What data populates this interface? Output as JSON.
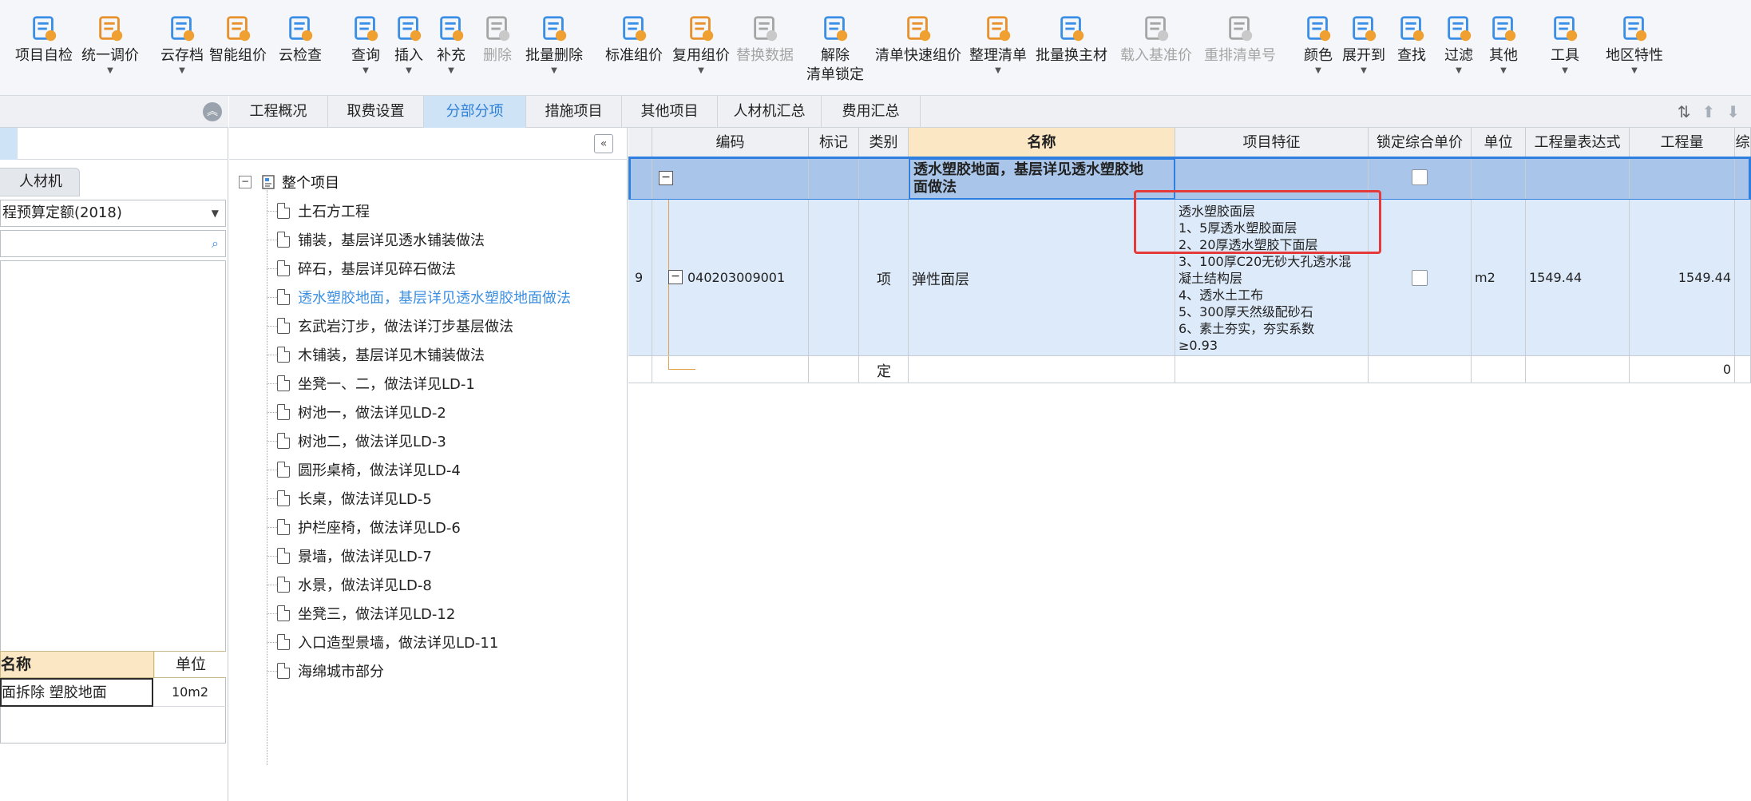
{
  "toolbar": {
    "buttons": [
      {
        "label": "项目自检",
        "icon": "check-doc-icon",
        "caret": false,
        "disabled": false
      },
      {
        "label": "统一调价",
        "icon": "adjust-price-icon",
        "caret": true,
        "disabled": false
      },
      {
        "label": "云存档",
        "icon": "cloud-save-icon",
        "caret": true,
        "disabled": false
      },
      {
        "label": "智能组价",
        "icon": "smart-price-icon",
        "caret": false,
        "disabled": false
      },
      {
        "label": "云检查",
        "icon": "cloud-check-icon",
        "caret": false,
        "disabled": false
      },
      {
        "label": "查询",
        "icon": "query-icon",
        "caret": true,
        "disabled": false
      },
      {
        "label": "插入",
        "icon": "insert-icon",
        "caret": true,
        "disabled": false
      },
      {
        "label": "补充",
        "icon": "supplement-icon",
        "caret": true,
        "disabled": false
      },
      {
        "label": "删除",
        "icon": "delete-icon",
        "caret": false,
        "disabled": true
      },
      {
        "label": "批量删除",
        "icon": "batch-delete-icon",
        "caret": true,
        "disabled": false
      },
      {
        "label": "标准组价",
        "icon": "standard-price-icon",
        "caret": false,
        "disabled": false
      },
      {
        "label": "复用组价",
        "icon": "reuse-price-icon",
        "caret": true,
        "disabled": false
      },
      {
        "label": "替换数据",
        "icon": "replace-data-icon",
        "caret": false,
        "disabled": true
      },
      {
        "label": "解除",
        "label2": "清单锁定",
        "icon": "unlock-icon",
        "caret": false,
        "disabled": false
      },
      {
        "label": "清单快速组价",
        "icon": "quick-price-icon",
        "caret": false,
        "disabled": false
      },
      {
        "label": "整理清单",
        "icon": "organize-list-icon",
        "caret": true,
        "disabled": false
      },
      {
        "label": "批量换主材",
        "icon": "batch-material-icon",
        "caret": false,
        "disabled": false
      },
      {
        "label": "载入基准价",
        "icon": "load-baseline-icon",
        "caret": false,
        "disabled": true
      },
      {
        "label": "重排清单号",
        "icon": "renumber-icon",
        "caret": false,
        "disabled": true
      },
      {
        "label": "颜色",
        "icon": "color-icon",
        "caret": true,
        "disabled": false
      },
      {
        "label": "展开到",
        "icon": "expand-to-icon",
        "caret": true,
        "disabled": false
      },
      {
        "label": "查找",
        "icon": "find-icon",
        "caret": false,
        "disabled": false
      },
      {
        "label": "过滤",
        "icon": "filter-icon",
        "caret": true,
        "disabled": false
      },
      {
        "label": "其他",
        "icon": "other-icon",
        "caret": true,
        "disabled": false
      },
      {
        "label": "工具",
        "icon": "tools-icon",
        "caret": true,
        "disabled": false
      },
      {
        "label": "地区特性",
        "icon": "region-feature-icon",
        "caret": true,
        "disabled": false
      }
    ]
  },
  "left_panel": {
    "tab_rcj": "人材机",
    "quota_select": "程预算定额(2018)",
    "sub_table": {
      "headers": [
        "名称",
        "单位"
      ],
      "row": {
        "name": "面拆除 塑胶地面",
        "unit": "10m2"
      }
    }
  },
  "tree": {
    "root": "整个项目",
    "items": [
      "土石方工程",
      "铺装，基层详见透水铺装做法",
      "碎石，基层详见碎石做法",
      "透水塑胶地面，基层详见透水塑胶地面做法",
      "玄武岩汀步，做法详汀步基层做法",
      "木铺装，基层详见木铺装做法",
      "坐凳一、二，做法详见LD-1",
      "树池一，做法详见LD-2",
      "树池二，做法详见LD-3",
      "圆形桌椅，做法详见LD-4",
      "长桌，做法详见LD-5",
      "护栏座椅，做法详见LD-6",
      "景墙，做法详见LD-7",
      "水景，做法详见LD-8",
      "坐凳三，做法详见LD-12",
      "入口造型景墙，做法详见LD-11",
      "海绵城市部分"
    ],
    "selected_index": 3
  },
  "tabs": [
    "工程概况",
    "取费设置",
    "分部分项",
    "措施项目",
    "其他项目",
    "人材机汇总",
    "费用汇总"
  ],
  "active_tab": 2,
  "grid": {
    "headers": [
      "编码",
      "标记",
      "类别",
      "名称",
      "项目特征",
      "锁定综合单价",
      "单位",
      "工程量表达式",
      "工程量",
      "综"
    ],
    "row1": {
      "toggle": "−",
      "name_line1": "透水塑胶地面，基层详见透水塑胶地",
      "name_line2": "面做法"
    },
    "row2": {
      "index": "9",
      "code": "040203009001",
      "category": "项",
      "name": "弹性面层",
      "features": [
        "透水塑胶面层",
        "1、5厚透水塑胶面层",
        "2、20厚透水塑胶下面层",
        "3、100厚C20无砂大孔透水混",
        "凝土结构层",
        "4、透水土工布",
        "5、300厚天然级配砂石",
        "6、素土夯实，夯实系数",
        "≥0.93"
      ],
      "unit": "m2",
      "expr": "1549.44",
      "qty": "1549.44"
    },
    "row3": {
      "category": "定",
      "qty": "0"
    }
  },
  "colors": {
    "accent": "#2f80d8",
    "selected_row": "#a9c6ea",
    "detail_row": "#ddeafa",
    "name_header": "#fbe7c4",
    "highlight_box": "#e53a3a"
  }
}
